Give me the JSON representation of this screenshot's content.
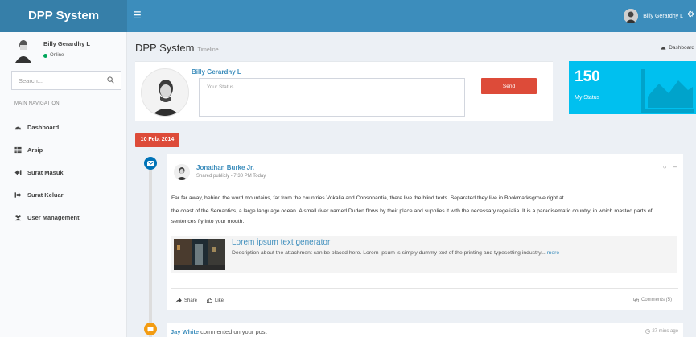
{
  "app": {
    "logo": "DPP System"
  },
  "topbar": {
    "user_name": "Billy Gerardhy L"
  },
  "sidebar": {
    "user_name": "Billy Gerardhy L",
    "user_status": "Online",
    "search_placeholder": "Search...",
    "nav_header": "MAIN NAVIGATION",
    "items": [
      {
        "label": "Dashboard",
        "icon": "dashboard-icon"
      },
      {
        "label": "Arsip",
        "icon": "table-icon"
      },
      {
        "label": "Surat Masuk",
        "icon": "sign-in-icon"
      },
      {
        "label": "Surat Keluar",
        "icon": "sign-out-icon"
      },
      {
        "label": "User Management",
        "icon": "users-icon"
      }
    ]
  },
  "header": {
    "title": "DPP System",
    "subtitle": "Timeline",
    "breadcrumb": "Dashboard"
  },
  "status_box": {
    "name": "Billy Gerardhy L",
    "placeholder": "Your Status",
    "send_label": "Send"
  },
  "info_box": {
    "value": "150",
    "label": "My Status"
  },
  "timeline": {
    "date_label": "10 Feb. 2014",
    "post": {
      "author": "Jonathan Burke Jr.",
      "meta": "Shared publicly - 7:30 PM Today",
      "paragraph1": "Far far away, behind the word mountains, far from the countries Vokalia and Consonantia, there live the blind texts. Separated they live in Bookmarksgrove right at",
      "paragraph2": "the coast of the Semantics, a large language ocean. A small river named Duden flows by their place and supplies it with the necessary regelialia. It is a paradisematic country, in which roasted parts of sentences fly into your mouth.",
      "attachment_title": "Lorem ipsum text generator",
      "attachment_desc": "Description about the attachment can be placed here. Lorem Ipsum is simply dummy text of the printing and typesetting industry...",
      "attachment_more": "more",
      "share_label": "Share",
      "like_label": "Like",
      "comments_label": "Comments (5)"
    },
    "next": {
      "author": "Jay White",
      "text": " commented on your post",
      "time": "27 mins ago"
    }
  },
  "colors": {
    "topbar": "#3c8dbc",
    "logo_bg": "#367fa9",
    "danger": "#dd4b39",
    "info": "#00c0ef",
    "timeline_blue": "#0073b7",
    "timeline_yellow": "#f39c12"
  }
}
